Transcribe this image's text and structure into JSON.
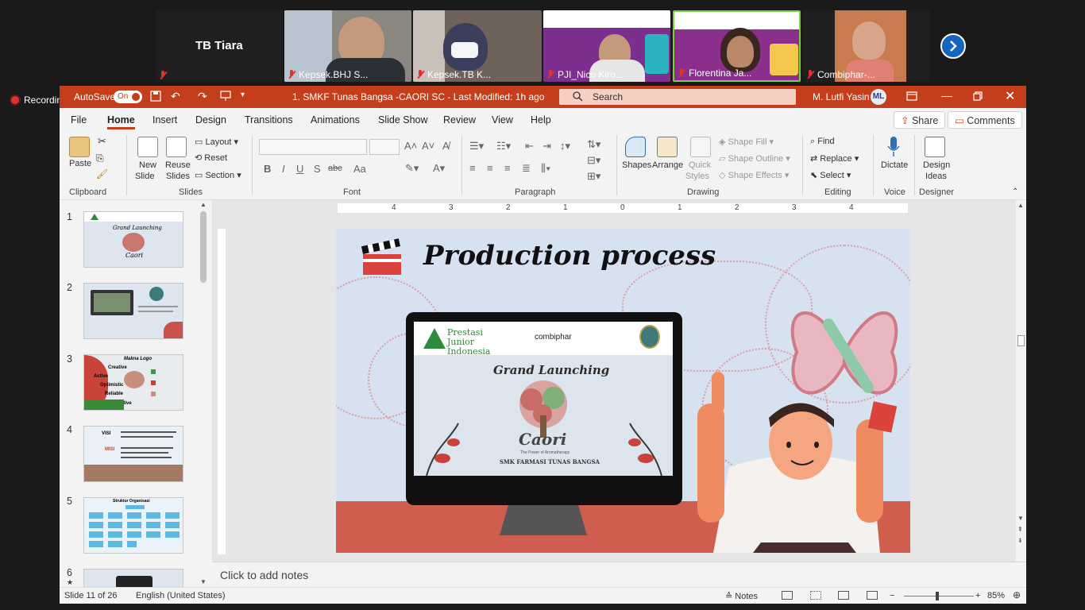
{
  "meeting": {
    "active_speaker_name": "TB Tiara",
    "participants": [
      {
        "name": "Kepsek.BHJ S..."
      },
      {
        "name": "Kepsek.TB K..."
      },
      {
        "name": "PJI_Nico Kiro..."
      },
      {
        "name": "Florentina Ja..."
      },
      {
        "name": "Combiphar-..."
      }
    ],
    "recording_label": "Recording"
  },
  "titlebar": {
    "autosave_label": "AutoSave",
    "autosave_state": "On",
    "document_title": "1. SMKF Tunas Bangsa -CAORI SC  -  Last Modified: 1h ago",
    "search_placeholder": "Search",
    "user_name": "M. Lutfi Yasin",
    "user_initials": "ML"
  },
  "menu": {
    "tabs": [
      "File",
      "Home",
      "Insert",
      "Design",
      "Transitions",
      "Animations",
      "Slide Show",
      "Review",
      "View",
      "Help"
    ],
    "active": "Home",
    "share_label": "Share",
    "comments_label": "Comments"
  },
  "ribbon": {
    "clipboard": {
      "paste": "Paste",
      "group": "Clipboard"
    },
    "slides": {
      "new_slide": "New",
      "new_slide_2": "Slide",
      "reuse": "Reuse",
      "reuse_2": "Slides",
      "layout": "Layout",
      "reset": "Reset",
      "section": "Section",
      "group": "Slides"
    },
    "font": {
      "group": "Font",
      "bold": "B",
      "italic": "I",
      "underline": "U",
      "shadow": "S",
      "strike": "abc",
      "case": "Aa"
    },
    "paragraph": {
      "group": "Paragraph"
    },
    "drawing": {
      "shapes": "Shapes",
      "arrange": "Arrange",
      "quick": "Quick",
      "quick_2": "Styles",
      "fill": "Shape Fill",
      "outline": "Shape Outline",
      "effects": "Shape Effects",
      "group": "Drawing"
    },
    "editing": {
      "find": "Find",
      "replace": "Replace",
      "select": "Select",
      "group": "Editing"
    },
    "voice": {
      "dictate": "Dictate",
      "group": "Voice"
    },
    "designer": {
      "ideas": "Design",
      "ideas_2": "Ideas",
      "group": "Designer"
    }
  },
  "thumbnails": [
    {
      "num": "1",
      "title": "Grand Launching"
    },
    {
      "num": "2",
      "title": ""
    },
    {
      "num": "3",
      "title": "Makna Logo"
    },
    {
      "num": "4",
      "title": "VISI"
    },
    {
      "num": "5",
      "title": "Struktur Organisasi"
    },
    {
      "num": "6"
    }
  ],
  "thumb_text": {
    "t3_words": [
      "Creative",
      "Active",
      "Optimistic",
      "Reliable",
      "Innovative"
    ],
    "t4_misi": "MISI",
    "caori": "Caori"
  },
  "ruler_labels": [
    "4",
    "3",
    "2",
    "1",
    "0",
    "1",
    "2",
    "3",
    "4"
  ],
  "slide": {
    "title": "Production process",
    "screen_brand_left": "Prestasi Junior Indonesia",
    "screen_brand_right": "combiphar",
    "screen_heading": "Grand Launching",
    "screen_logo": "Caori",
    "screen_tagline": "The Power of Aromatherapy",
    "screen_school": "SMK FARMASI TUNAS BANGSA"
  },
  "notes_placeholder": "Click to add notes",
  "status": {
    "slide_info": "Slide 11 of 26",
    "language": "English (United States)",
    "notes": "Notes",
    "zoom": "85%"
  },
  "colors": {
    "ppt_accent": "#c43e1c",
    "recording_red": "#e0312b"
  }
}
